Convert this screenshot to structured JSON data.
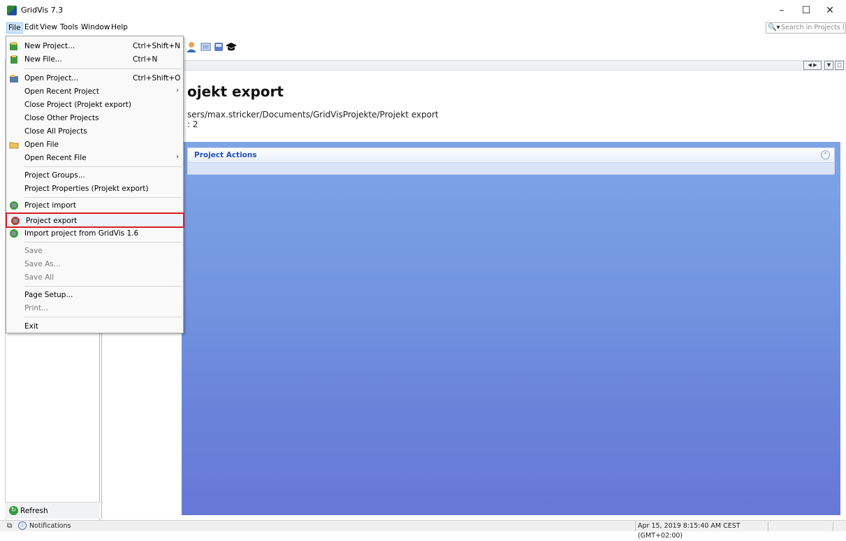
{
  "window": {
    "title": "GridVis 7.3",
    "minimize": "–",
    "maximize": "☐",
    "close": "✕"
  },
  "menubar": {
    "items": [
      "File",
      "Edit",
      "View",
      "Tools",
      "Window",
      "Help"
    ]
  },
  "search": {
    "placeholder": "Search in Projects (Ctrl+I)"
  },
  "file_menu": {
    "new_project": {
      "label": "New Project...",
      "shortcut": "Ctrl+Shift+N"
    },
    "new_file": {
      "label": "New File...",
      "shortcut": "Ctrl+N"
    },
    "open_project": {
      "label": "Open Project...",
      "shortcut": "Ctrl+Shift+O"
    },
    "open_recent_project": {
      "label": "Open Recent Project"
    },
    "close_project": {
      "label": "Close Project (Projekt export)"
    },
    "close_other": {
      "label": "Close Other Projects"
    },
    "close_all": {
      "label": "Close All Projects"
    },
    "open_file": {
      "label": "Open File"
    },
    "open_recent_file": {
      "label": "Open Recent File"
    },
    "project_groups": {
      "label": "Project Groups..."
    },
    "project_properties": {
      "label": "Project Properties (Projekt export)"
    },
    "project_import": {
      "label": "Project import"
    },
    "project_export": {
      "label": "Project export"
    },
    "import_gridvis": {
      "label": "Import project from GridVis 1.6"
    },
    "save": {
      "label": "Save"
    },
    "save_as": {
      "label": "Save As..."
    },
    "save_all": {
      "label": "Save All"
    },
    "page_setup": {
      "label": "Page Setup..."
    },
    "print": {
      "label": "Print..."
    },
    "exit": {
      "label": "Exit"
    },
    "submenu_arrow": "›"
  },
  "project": {
    "title": "ojekt export",
    "path": "sers/max.stricker/Documents/GridVisProjekte/Projekt export",
    "count": ": 2"
  },
  "actions": {
    "title": "Project Actions",
    "collapse": "⌃"
  },
  "left_panel": {
    "refresh": "Refresh"
  },
  "statusbar": {
    "notifications": "Notifications",
    "timestamp": "Apr 15, 2019 8:15:40 AM CEST (GMT+02:00)"
  },
  "colors": {
    "highlight_border": "#d81e24",
    "panel_blue": "#7395e0",
    "accent_text": "#2454b8"
  }
}
